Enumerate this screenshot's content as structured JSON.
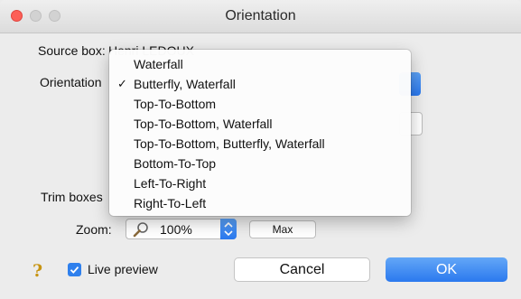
{
  "window": {
    "title": "Orientation"
  },
  "source": {
    "label": "Source box:",
    "value": "Henri LEDOUX"
  },
  "orientation": {
    "label": "Orientation",
    "menu_items": [
      {
        "label": "Waterfall",
        "checked": false
      },
      {
        "label": "Butterfly, Waterfall",
        "checked": true
      },
      {
        "label": "Top-To-Bottom",
        "checked": false
      },
      {
        "label": "Top-To-Bottom, Waterfall",
        "checked": false
      },
      {
        "label": "Top-To-Bottom, Butterfly, Waterfall",
        "checked": false
      },
      {
        "label": "Bottom-To-Top",
        "checked": false
      },
      {
        "label": "Left-To-Right",
        "checked": false
      },
      {
        "label": "Right-To-Left",
        "checked": false
      }
    ],
    "check_glyph": "✓"
  },
  "trim": {
    "label": "Trim boxes"
  },
  "zoom": {
    "label": "Zoom:",
    "value": "100%",
    "max_label": "Max",
    "icon": "magnifier-icon"
  },
  "footer": {
    "help_glyph": "?",
    "live_preview_label": "Live preview",
    "live_preview_checked": true,
    "cancel_label": "Cancel",
    "ok_label": "OK"
  },
  "colors": {
    "accent": "#2f80ed",
    "close": "#fc5f57",
    "help": "#c79412"
  }
}
